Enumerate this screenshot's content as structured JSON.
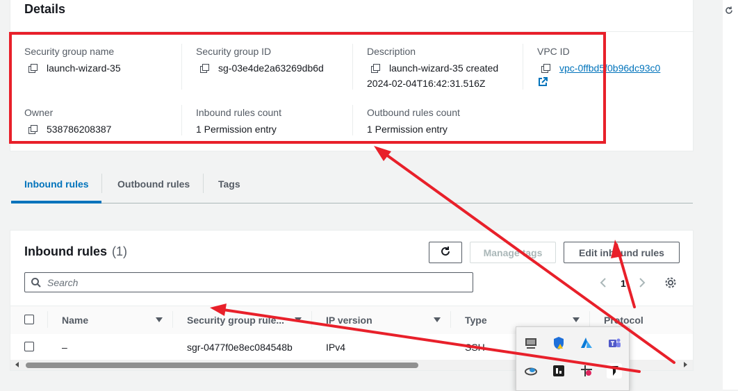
{
  "details": {
    "title": "Details",
    "fields": {
      "sg_name": {
        "label": "Security group name",
        "value": "launch-wizard-35"
      },
      "sg_id": {
        "label": "Security group ID",
        "value": "sg-03e4de2a63269db6d"
      },
      "description": {
        "label": "Description",
        "value_line1": "launch-wizard-35 created",
        "value_line2": "2024-02-04T16:42:31.516Z"
      },
      "vpc_id": {
        "label": "VPC ID",
        "value": "vpc-0ffbd5f0b96dc93c0"
      },
      "owner": {
        "label": "Owner",
        "value": "538786208387"
      },
      "inbound_count": {
        "label": "Inbound rules count",
        "value": "1 Permission entry"
      },
      "outbound_count": {
        "label": "Outbound rules count",
        "value": "1 Permission entry"
      }
    }
  },
  "tabs": [
    {
      "label": "Inbound rules",
      "active": true
    },
    {
      "label": "Outbound rules",
      "active": false
    },
    {
      "label": "Tags",
      "active": false
    }
  ],
  "inbound": {
    "title": "Inbound rules",
    "count": "(1)",
    "manage_tags_label": "Manage tags",
    "edit_label": "Edit inbound rules",
    "search_placeholder": "Search",
    "page_number": "1",
    "columns": [
      "Name",
      "Security group rule...",
      "IP version",
      "Type",
      "Protocol"
    ],
    "rows": [
      {
        "name": "–",
        "rule_id": "sgr-0477f0e8ec084548b",
        "ip_version": "IPv4",
        "type": "SSH"
      }
    ]
  },
  "colors": {
    "annotation": "#e8202a",
    "link": "#0073bb"
  }
}
